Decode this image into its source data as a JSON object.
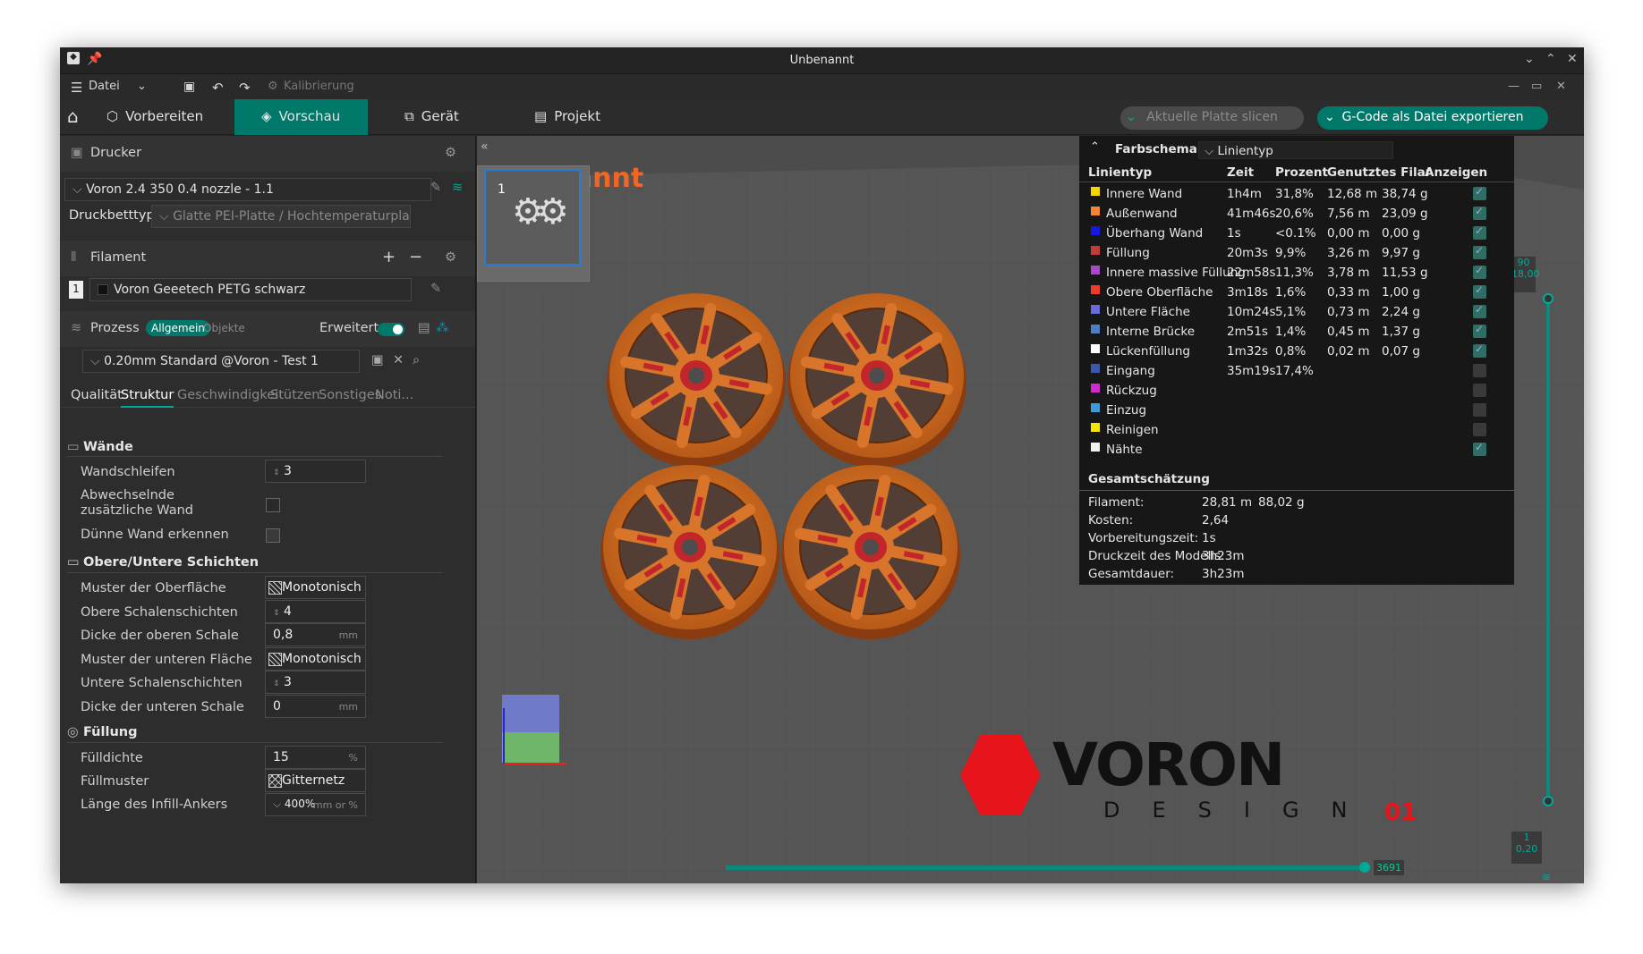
{
  "window": {
    "title": "Unbenannt"
  },
  "menubar": {
    "file": "Datei",
    "calibration": "Kalibrierung"
  },
  "tabs": {
    "prepare": "Vorbereiten",
    "preview": "Vorschau",
    "device": "Gerät",
    "project": "Projekt"
  },
  "actions": {
    "slice": "Aktuelle Platte slicen",
    "export": "G-Code als Datei exportieren"
  },
  "printer": {
    "section": "Drucker",
    "profile": "Voron 2.4 350 0.4 nozzle - 1.1",
    "bed_label": "Druckbetttyp",
    "bed_value": "Glatte PEI-Platte / Hochtemperaturplatte"
  },
  "filament": {
    "section": "Filament",
    "slot": "1",
    "name": "Voron Geeetech PETG schwarz"
  },
  "process": {
    "section": "Prozess",
    "toggle_global": "Allgemein",
    "toggle_objects": "Objekte",
    "advanced": "Erweitert",
    "preset": "0.20mm Standard @Voron - Test 1",
    "subtabs": [
      "Qualität",
      "Struktur",
      "Geschwindigkeit",
      "Stützen",
      "Sonstiges",
      "Noti..."
    ],
    "active_subtab": "Struktur"
  },
  "settings": {
    "walls": {
      "title": "Wände",
      "loops_label": "Wandschleifen",
      "loops_value": "3",
      "alt_label": "Abwechselnde zusätzliche Wand",
      "thin_label": "Dünne Wand erkennen"
    },
    "shells": {
      "title": "Obere/Untere Schichten",
      "top_pattern_label": "Muster der Oberfläche",
      "top_pattern_value": "Monotonisch",
      "top_layers_label": "Obere Schalenschichten",
      "top_layers_value": "4",
      "top_thick_label": "Dicke der oberen Schale",
      "top_thick_value": "0,8",
      "unit_mm": "mm",
      "bottom_pattern_label": "Muster der unteren Fläche",
      "bottom_pattern_value": "Monotonisch",
      "bottom_layers_label": "Untere Schalenschichten",
      "bottom_layers_value": "3",
      "bottom_thick_label": "Dicke der unteren Schale",
      "bottom_thick_value": "0"
    },
    "infill": {
      "title": "Füllung",
      "density_label": "Fülldichte",
      "density_value": "15",
      "unit_pct": "%",
      "pattern_label": "Füllmuster",
      "pattern_value": "Gitternetz",
      "anchor_label": "Länge des Infill-Ankers",
      "anchor_value": "400%",
      "anchor_unit": "mm or %"
    }
  },
  "viewport": {
    "plate_title": "Unbenannt",
    "plate_number": "1",
    "logo_text": "VORON",
    "logo_sub": "DESIGN",
    "logo_num": "01",
    "layer_top": "90",
    "layer_top_h": "18,00",
    "layer_bot": "1",
    "layer_bot_h": "0,20",
    "moves": "3691"
  },
  "stats": {
    "scheme_label": "Farbschema",
    "scheme_value": "Linientyp",
    "headers": [
      "Linientyp",
      "Zeit",
      "Prozent",
      "Genutztes Filament",
      "Anzeigen"
    ],
    "rows": [
      {
        "name": "Innere Wand",
        "time": "1h4m",
        "pct": "31,8%",
        "len": "12,68 m",
        "wt": "38,74 g",
        "color": "#f5d400",
        "on": true
      },
      {
        "name": "Außenwand",
        "time": "41m46s",
        "pct": "20,6%",
        "len": "7,56 m",
        "wt": "23,09 g",
        "color": "#f58433",
        "on": true
      },
      {
        "name": "Überhang Wand",
        "time": "1s",
        "pct": "<0.1%",
        "len": "0,00 m",
        "wt": "0,00 g",
        "color": "#1818e0",
        "on": true
      },
      {
        "name": "Füllung",
        "time": "20m3s",
        "pct": "9,9%",
        "len": "3,26 m",
        "wt": "9,97 g",
        "color": "#c33b3b",
        "on": true
      },
      {
        "name": "Innere massive Füllung",
        "time": "22m58s",
        "pct": "11,3%",
        "len": "3,78 m",
        "wt": "11,53 g",
        "color": "#a64bc6",
        "on": true
      },
      {
        "name": "Obere Oberfläche",
        "time": "3m18s",
        "pct": "1,6%",
        "len": "0,33 m",
        "wt": "1,00 g",
        "color": "#ef3b28",
        "on": true
      },
      {
        "name": "Untere Fläche",
        "time": "10m24s",
        "pct": "5,1%",
        "len": "0,73 m",
        "wt": "2,24 g",
        "color": "#6a6ad8",
        "on": true
      },
      {
        "name": "Interne Brücke",
        "time": "2m51s",
        "pct": "1,4%",
        "len": "0,45 m",
        "wt": "1,37 g",
        "color": "#4d7fc4",
        "on": true
      },
      {
        "name": "Lückenfüllung",
        "time": "1m32s",
        "pct": "0,8%",
        "len": "0,02 m",
        "wt": "0,07 g",
        "color": "#ffffff",
        "on": true
      },
      {
        "name": "Eingang",
        "time": "35m19s",
        "pct": "17,4%",
        "len": "",
        "wt": "",
        "color": "#3a5ab0",
        "on": false
      },
      {
        "name": "Rückzug",
        "time": "",
        "pct": "",
        "len": "",
        "wt": "",
        "color": "#d02ad0",
        "on": false
      },
      {
        "name": "Einzug",
        "time": "",
        "pct": "",
        "len": "",
        "wt": "",
        "color": "#3f9bd6",
        "on": false
      },
      {
        "name": "Reinigen",
        "time": "",
        "pct": "",
        "len": "",
        "wt": "",
        "color": "#f5e600",
        "on": false
      },
      {
        "name": "Nähte",
        "time": "",
        "pct": "",
        "len": "",
        "wt": "",
        "color": "#f0f0f0",
        "on": true
      }
    ],
    "summary_title": "Gesamtschätzung",
    "summary": [
      {
        "label": "Filament:",
        "value": "28,81 m",
        "extra": "88,02 g"
      },
      {
        "label": "Kosten:",
        "value": "2,64",
        "extra": ""
      },
      {
        "label": "Vorbereitungszeit:",
        "value": "1s",
        "extra": ""
      },
      {
        "label": "Druckzeit des Modells:",
        "value": "3h23m",
        "extra": ""
      },
      {
        "label": "Gesamtdauer:",
        "value": "3h23m",
        "extra": ""
      }
    ]
  }
}
